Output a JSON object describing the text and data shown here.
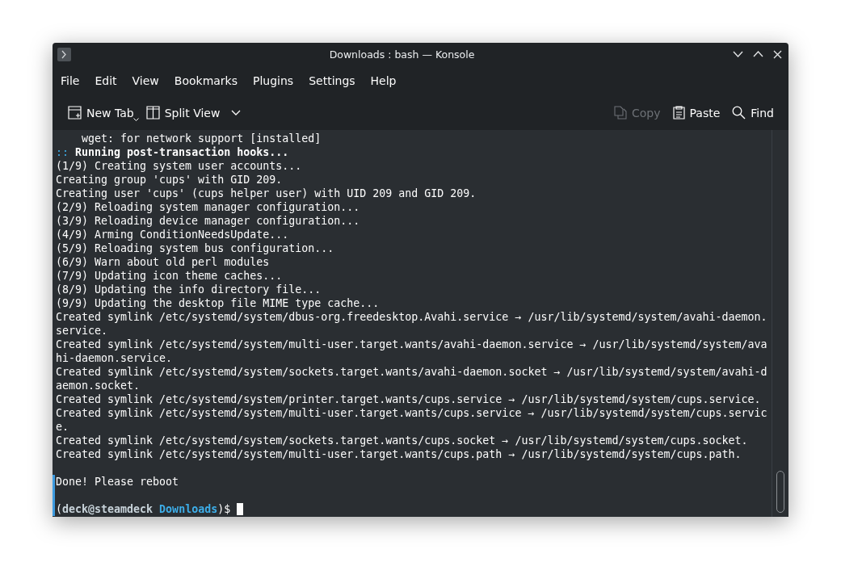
{
  "window": {
    "title": "Downloads : bash — Konsole"
  },
  "menu": [
    "File",
    "Edit",
    "View",
    "Bookmarks",
    "Plugins",
    "Settings",
    "Help"
  ],
  "toolbar": [
    {
      "kind": "new-tab",
      "label": "New Tab",
      "disabled": false
    },
    {
      "kind": "split-view",
      "label": "Split View",
      "disabled": false
    },
    {
      "kind": "copy",
      "label": "Copy",
      "disabled": true
    },
    {
      "kind": "paste",
      "label": "Paste",
      "disabled": false
    },
    {
      "kind": "find",
      "label": "Find",
      "disabled": false
    }
  ],
  "terminal": {
    "lines": [
      {
        "kind": "text",
        "text": "    wget: for network support [installed]"
      },
      {
        "kind": "heading",
        "marker": "::",
        "text": "Running post-transaction hooks..."
      },
      {
        "kind": "text",
        "text": "(1/9) Creating system user accounts..."
      },
      {
        "kind": "text",
        "text": "Creating group 'cups' with GID 209."
      },
      {
        "kind": "text",
        "text": "Creating user 'cups' (cups helper user) with UID 209 and GID 209."
      },
      {
        "kind": "text",
        "text": "(2/9) Reloading system manager configuration..."
      },
      {
        "kind": "text",
        "text": "(3/9) Reloading device manager configuration..."
      },
      {
        "kind": "text",
        "text": "(4/9) Arming ConditionNeedsUpdate..."
      },
      {
        "kind": "text",
        "text": "(5/9) Reloading system bus configuration..."
      },
      {
        "kind": "text",
        "text": "(6/9) Warn about old perl modules"
      },
      {
        "kind": "text",
        "text": "(7/9) Updating icon theme caches..."
      },
      {
        "kind": "text",
        "text": "(8/9) Updating the info directory file..."
      },
      {
        "kind": "text",
        "text": "(9/9) Updating the desktop file MIME type cache..."
      },
      {
        "kind": "text",
        "text": "Created symlink /etc/systemd/system/dbus-org.freedesktop.Avahi.service → /usr/lib/systemd/system/avahi-daemon."
      },
      {
        "kind": "text",
        "text": "service."
      },
      {
        "kind": "text",
        "text": "Created symlink /etc/systemd/system/multi-user.target.wants/avahi-daemon.service → /usr/lib/systemd/system/ava"
      },
      {
        "kind": "text",
        "text": "hi-daemon.service."
      },
      {
        "kind": "text",
        "text": "Created symlink /etc/systemd/system/sockets.target.wants/avahi-daemon.socket → /usr/lib/systemd/system/avahi-d"
      },
      {
        "kind": "text",
        "text": "aemon.socket."
      },
      {
        "kind": "text",
        "text": "Created symlink /etc/systemd/system/printer.target.wants/cups.service → /usr/lib/systemd/system/cups.service."
      },
      {
        "kind": "text",
        "text": "Created symlink /etc/systemd/system/multi-user.target.wants/cups.service → /usr/lib/systemd/system/cups.servic"
      },
      {
        "kind": "text",
        "text": "e."
      },
      {
        "kind": "text",
        "text": "Created symlink /etc/systemd/system/sockets.target.wants/cups.socket → /usr/lib/systemd/system/cups.socket."
      },
      {
        "kind": "text",
        "text": "Created symlink /etc/systemd/system/multi-user.target.wants/cups.path → /usr/lib/systemd/system/cups.path."
      },
      {
        "kind": "blank"
      },
      {
        "kind": "text",
        "text": "Done! Please reboot",
        "marked": true
      },
      {
        "kind": "blank",
        "marked": true
      },
      {
        "kind": "prompt",
        "open": "(",
        "user_host": "deck@steamdeck",
        "directory": "Downloads",
        "close": ")$",
        "marked": true
      }
    ]
  }
}
